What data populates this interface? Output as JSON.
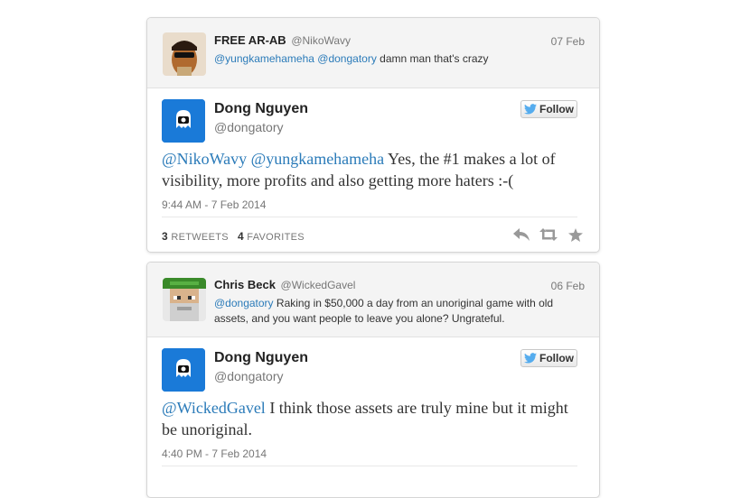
{
  "tweets": [
    {
      "parent": {
        "name": "FREE AR-AB",
        "handle": "@NikoWavy",
        "date": "07 Feb",
        "mention1": "@yungkamehameha",
        "mention2": "@dongatory",
        "text": "damn man that's crazy"
      },
      "reply": {
        "name": "Dong Nguyen",
        "handle": "@dongatory",
        "follow_label": "Follow",
        "mention1": "@NikoWavy",
        "mention2": "@yungkamehameha",
        "text": "Yes, the #1 makes a lot of visibility, more profits and also getting more haters :-(",
        "time": "9:44 AM - 7 Feb 2014",
        "retweets": "3",
        "retweets_label": "RETWEETS",
        "favorites": "4",
        "favorites_label": "FAVORITES"
      }
    },
    {
      "parent": {
        "name": "Chris Beck",
        "handle": "@WickedGavel",
        "date": "06 Feb",
        "mention1": "@dongatory",
        "text": "Raking in $50,000 a day from an unoriginal game with old assets, and you want people to leave you alone? Ungrateful."
      },
      "reply": {
        "name": "Dong Nguyen",
        "handle": "@dongatory",
        "follow_label": "Follow",
        "mention1": "@WickedGavel",
        "text": "I think those assets are truly mine but it might be unoriginal.",
        "time": "4:40 PM - 7 Feb 2014"
      }
    }
  ],
  "icons": {
    "twitter_bird": "twitter-bird-icon",
    "reply": "reply-icon",
    "retweet": "retweet-icon",
    "favorite": "star-icon"
  },
  "colors": {
    "link": "#2b7bb9",
    "twitter_blue": "#1a7ad8"
  }
}
